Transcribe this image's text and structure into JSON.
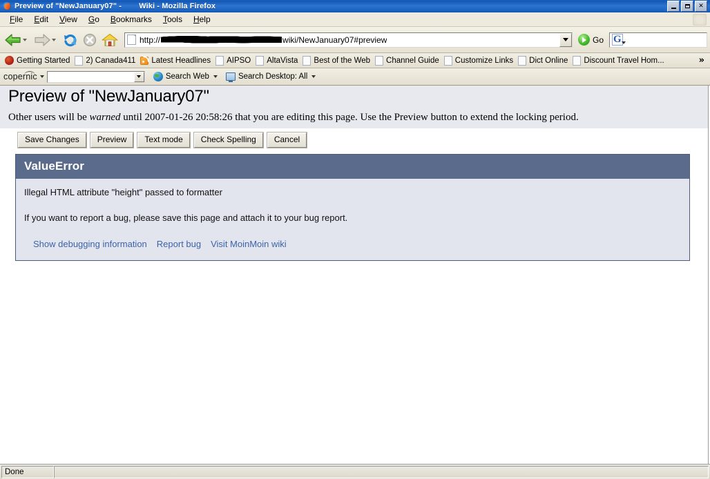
{
  "window": {
    "title": "Preview of \"NewJanuary07\" -        Wiki - Mozilla Firefox",
    "icon": "firefox-icon",
    "controls": {
      "minimize": "_",
      "restore": "❐",
      "close": "×"
    }
  },
  "menu": {
    "items": [
      {
        "label": "File"
      },
      {
        "label": "Edit"
      },
      {
        "label": "View"
      },
      {
        "label": "Go"
      },
      {
        "label": "Bookmarks"
      },
      {
        "label": "Tools"
      },
      {
        "label": "Help"
      }
    ]
  },
  "navbar": {
    "back": "back-icon",
    "forward": "forward-icon",
    "reload": "reload-icon",
    "stop": "stop-icon",
    "home": "home-icon",
    "url_prefix": "http://",
    "url_suffix": "wiki/NewJanuary07#preview",
    "url_redacted": true,
    "go_label": "Go",
    "search_placeholder": "",
    "search_value": "",
    "search_engine_icon": "google-g-icon"
  },
  "bookmarks": {
    "items": [
      {
        "label": "Getting Started",
        "icon": "firefox-bookmark-icon"
      },
      {
        "label": "2) Canada411",
        "icon": "page-icon"
      },
      {
        "label": "Latest Headlines",
        "icon": "rss-icon"
      },
      {
        "label": "AIPSO",
        "icon": "page-icon"
      },
      {
        "label": "AltaVista",
        "icon": "page-icon"
      },
      {
        "label": "Best of the Web",
        "icon": "page-icon"
      },
      {
        "label": "Channel Guide",
        "icon": "page-icon"
      },
      {
        "label": "Customize Links",
        "icon": "page-icon"
      },
      {
        "label": "Dict Online",
        "icon": "page-icon"
      },
      {
        "label": "Discount Travel Hom...",
        "icon": "page-icon"
      }
    ],
    "overflow": "»"
  },
  "copernic": {
    "brand": "copernic",
    "query_value": "",
    "search_web_label": "Search Web",
    "search_desktop_label": "Search Desktop: All"
  },
  "page": {
    "title": "Preview of \"NewJanuary07\"",
    "warning_before": "Other users will be ",
    "warning_emphasis": "warned",
    "warning_after": " until 2007-01-26 20:58:26 that you are editing this page. Use the Preview button to extend the locking period.",
    "buttons": [
      {
        "label": "Save Changes"
      },
      {
        "label": "Preview"
      },
      {
        "label": "Text mode"
      },
      {
        "label": "Check Spelling"
      },
      {
        "label": "Cancel"
      }
    ],
    "error": {
      "heading": "ValueError",
      "message": "Illegal HTML attribute \"height\" passed to formatter",
      "advice": "If you want to report a bug, please save this page and attach it to your bug report.",
      "links": [
        {
          "label": "Show debugging information"
        },
        {
          "label": "Report bug"
        },
        {
          "label": "Visit MoinMoin wiki"
        }
      ]
    }
  },
  "statusbar": {
    "text": "Done"
  },
  "colors": {
    "titlebar": "#1357b4",
    "error_header": "#5b6b8c",
    "error_body": "#e3e5ee",
    "link": "#3b64a8",
    "page_header_bg": "#e8e8ef"
  }
}
